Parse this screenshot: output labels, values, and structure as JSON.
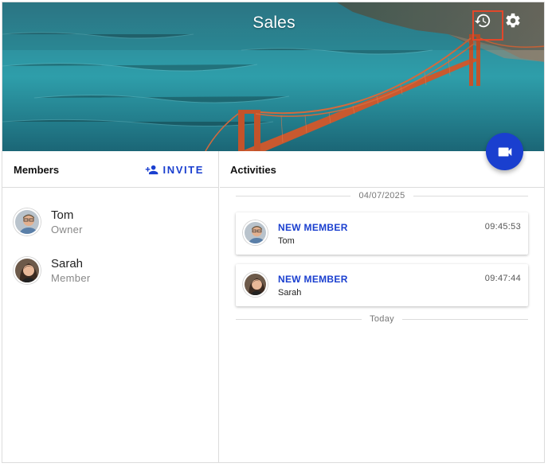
{
  "header": {
    "title": "Sales",
    "icons": {
      "history": "history-icon",
      "settings": "gear-icon",
      "video": "videocam-icon"
    },
    "colors": {
      "accent": "#1a3fcf",
      "highlight_box": "#e2472a"
    }
  },
  "members": {
    "title": "Members",
    "invite_label": "INVITE",
    "invite_icon": "person-add-icon",
    "items": [
      {
        "name": "Tom",
        "role": "Owner"
      },
      {
        "name": "Sarah",
        "role": "Member"
      }
    ]
  },
  "activities": {
    "title": "Activities",
    "date_separators": [
      "04/07/2025",
      "Today"
    ],
    "items": [
      {
        "type": "NEW MEMBER",
        "who": "Tom",
        "time": "09:45:53"
      },
      {
        "type": "NEW MEMBER",
        "who": "Sarah",
        "time": "09:47:44"
      }
    ]
  }
}
